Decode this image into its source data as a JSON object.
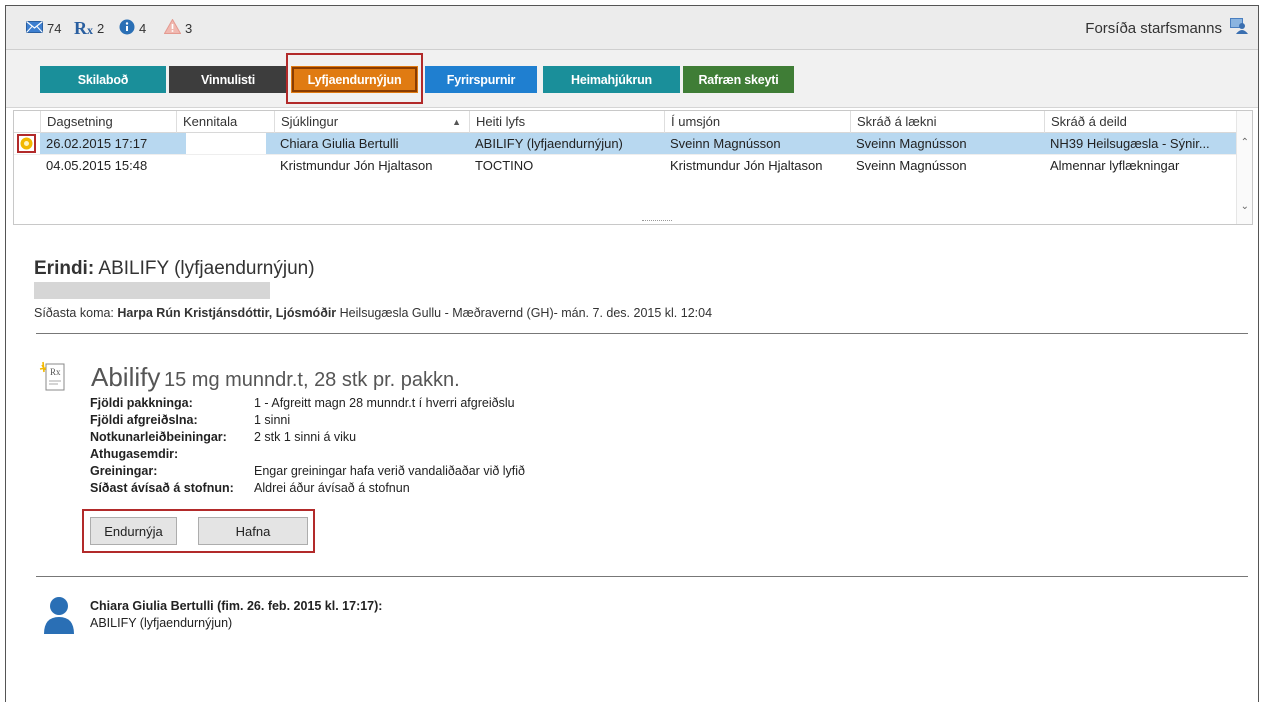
{
  "status": {
    "messages_count": "74",
    "rx_count": "2",
    "info_count": "4",
    "warning_count": "3",
    "home_link": "Forsíða starfsmanns"
  },
  "nav": {
    "skilabod": "Skilaboð",
    "vinnulisti": "Vinnulisti",
    "lyfjaendurnyjun": "Lyfjaendurnýjun",
    "fyrirspurnir": "Fyrirspurnir",
    "heimahjukrun": "Heimahjúkrun",
    "rafraen": "Rafræn skeyti"
  },
  "table": {
    "headers": [
      "Dagsetning",
      "Kennitala",
      "Sjúklingur",
      "Heiti lyfs",
      "Í umsjón",
      "Skráð á lækni",
      "Skráð á deild"
    ],
    "rows": [
      [
        "26.02.2015 17:17",
        "",
        "Chiara Giulia Bertulli",
        "ABILIFY (lyfjaendurnýjun)",
        "Sveinn Magnússon",
        "Sveinn Magnússon",
        "NH39 Heilsugæsla - Sýnir..."
      ],
      [
        "04.05.2015 15:48",
        "",
        "Kristmundur Jón Hjaltason",
        "TOCTINO",
        "Kristmundur Jón Hjaltason",
        "Sveinn Magnússon",
        "Almennar lyflækningar"
      ]
    ]
  },
  "detail": {
    "title_label": "Erindi:",
    "title_value": "ABILIFY (lyfjaendurnýjun)",
    "last_visit_label": "Síðasta koma:",
    "last_visit_person": "Harpa Rún Kristjánsdóttir, Ljósmóðir",
    "last_visit_rest": "Heilsugæsla Gullu - Mæðravernd (GH)- mán. 7. des. 2015 kl. 12:04",
    "drug_name": "Abilify",
    "drug_desc": "15 mg munndr.t, 28 stk pr. pakkn.",
    "fields": [
      {
        "label": "Fjöldi pakkninga:",
        "value": "1 - Afgreitt magn 28 munndr.t í hverri afgreiðslu"
      },
      {
        "label": "Fjöldi afgreiðslna:",
        "value": "1 sinni"
      },
      {
        "label": "Notkunarleiðbeiningar:",
        "value": "2 stk 1 sinni á viku"
      },
      {
        "label": "Athugasemdir:",
        "value": ""
      },
      {
        "label": "Greiningar:",
        "value": "Engar greiningar hafa verið vandaliðaðar við lyfið"
      },
      {
        "label": "Síðast ávísað á stofnun:",
        "value": "Aldrei áður ávísað á stofnun"
      }
    ],
    "renew_button": "Endurnýja",
    "reject_button": "Hafna"
  },
  "message": {
    "author": "Chiara Giulia Bertulli (fim. 26. feb. 2015 kl. 17:17):",
    "body": "ABILIFY (lyfjaendurnýjun)"
  },
  "colors": {
    "skilabod": "#1a8f9a",
    "vinnulisti": "#3d3d3d",
    "lyfjaendurnyjun": "#e07b12",
    "fyrirspurnir": "#1f7fd0",
    "heimahjukrun": "#1a8f9a",
    "rafraen": "#3f7d36",
    "selected_row": "#b8d8f0",
    "highlight_red": "#b22a2a",
    "person_icon": "#2a6fb5"
  }
}
